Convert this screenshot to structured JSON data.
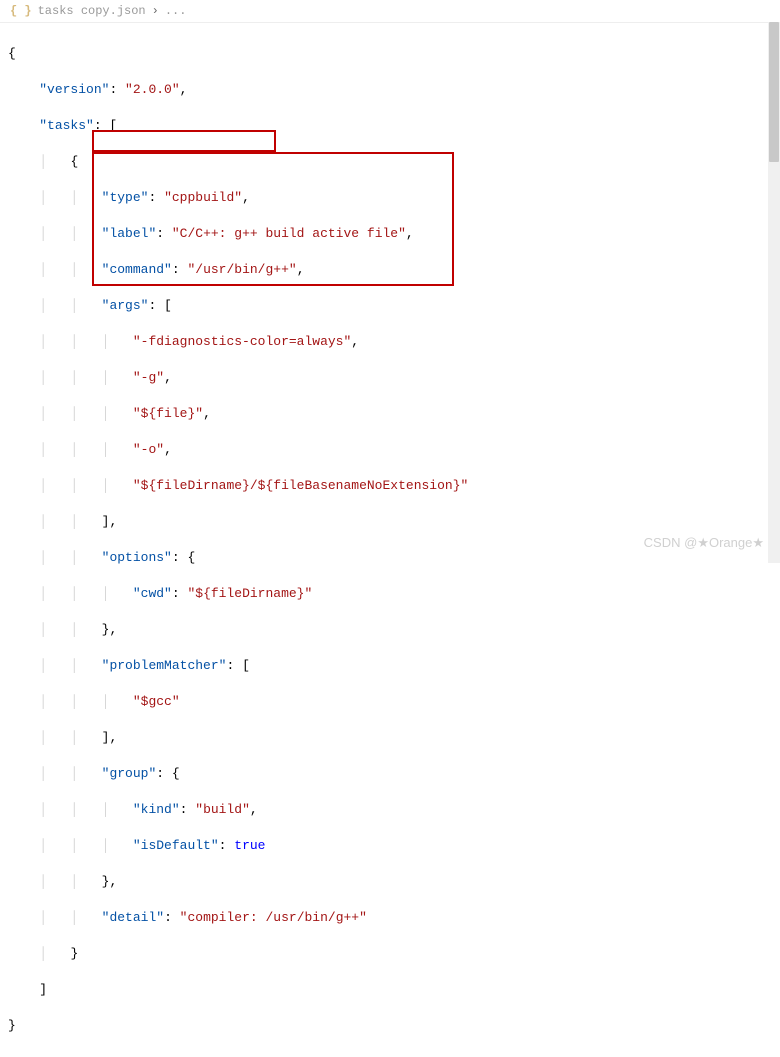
{
  "breadcrumb": {
    "fileName": "tasks copy.json",
    "ellipsis": "..."
  },
  "code": {
    "l1_brace": "{",
    "l2_key": "\"version\"",
    "l2_val": "\"2.0.0\"",
    "l3_key": "\"tasks\"",
    "l4_brace": "{",
    "l5_key": "\"type\"",
    "l5_val": "\"cppbuild\"",
    "l6_key": "\"label\"",
    "l6_val": "\"C/C++: g++ build active file\"",
    "l7_key": "\"command\"",
    "l7_val": "\"/usr/bin/g++\"",
    "l8_key": "\"args\"",
    "l9_val": "\"-fdiagnostics-color=always\"",
    "l10_val": "\"-g\"",
    "l11_val": "\"${file}\"",
    "l12_val": "\"-o\"",
    "l13_val": "\"${fileDirname}/${fileBasenameNoExtension}\"",
    "l14_close": "]",
    "l15_key": "\"options\"",
    "l16_key": "\"cwd\"",
    "l16_val": "\"${fileDirname}\"",
    "l17_close": "}",
    "l18_key": "\"problemMatcher\"",
    "l19_val": "\"$gcc\"",
    "l20_close": "]",
    "l21_key": "\"group\"",
    "l22_key": "\"kind\"",
    "l22_val": "\"build\"",
    "l23_key": "\"isDefault\"",
    "l23_val": "true",
    "l24_close": "}",
    "l25_key": "\"detail\"",
    "l25_val": "\"compiler: /usr/bin/g++\"",
    "l26_close": "}",
    "l27_close": "]",
    "l28_close": "}"
  },
  "watermark": "CSDN @★Orange★"
}
